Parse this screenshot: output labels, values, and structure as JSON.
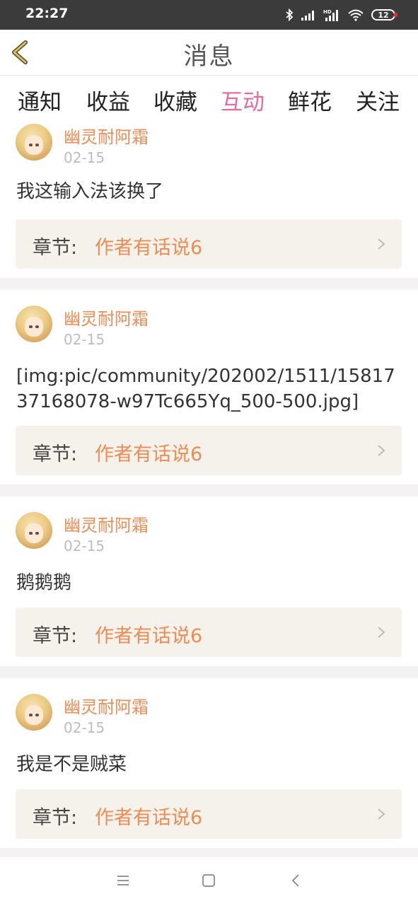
{
  "status_bar": {
    "time": "22:27",
    "battery": "12",
    "icons": [
      "bluetooth-icon",
      "signal-icon",
      "hd-signal-icon",
      "wifi-icon",
      "battery-icon"
    ]
  },
  "header": {
    "title": "消息",
    "back_icon": "chevron-left-icon"
  },
  "tabs": [
    {
      "label": "通知",
      "active": false
    },
    {
      "label": "收益",
      "active": false
    },
    {
      "label": "收藏",
      "active": false
    },
    {
      "label": "互动",
      "active": true
    },
    {
      "label": "鲜花",
      "active": false
    },
    {
      "label": "关注",
      "active": false
    }
  ],
  "colors": {
    "accent_pink": "#e86aa0",
    "name_orange": "#ef8c55",
    "status_bar": "#3b3b3b",
    "chapter_bg": "#f4f2ea"
  },
  "messages": [
    {
      "name": "幽灵耐阿霜",
      "date": "02-15",
      "text": "我这输入法该换了",
      "chapter_label": "章节:",
      "chapter_value": "作者有话说6"
    },
    {
      "name": "幽灵耐阿霜",
      "date": "02-15",
      "text": "[img:pic/community/202002/1511/1581737168078-w97Tc665Yq_500-500.jpg]",
      "chapter_label": "章节:",
      "chapter_value": "作者有话说6"
    },
    {
      "name": "幽灵耐阿霜",
      "date": "02-15",
      "text": "鹅鹅鹅",
      "chapter_label": "章节:",
      "chapter_value": "作者有话说6"
    },
    {
      "name": "幽灵耐阿霜",
      "date": "02-15",
      "text": "我是不是贼菜",
      "chapter_label": "章节:",
      "chapter_value": "作者有话说6"
    }
  ],
  "nav_bar": {
    "buttons": [
      "menu-icon",
      "home-square-icon",
      "back-triangle-icon"
    ]
  }
}
